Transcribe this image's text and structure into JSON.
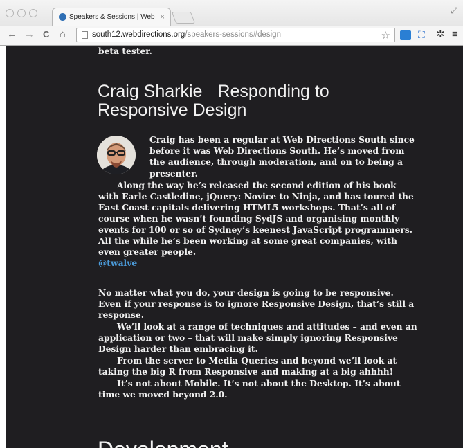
{
  "browser": {
    "tab_title": "Speakers & Sessions | Web D",
    "tab_close": "×",
    "url_host": "south12.webdirections.org",
    "url_path": "/speakers-sessions#design",
    "back": "←",
    "forward": "→",
    "reload": "C",
    "home": "⌂",
    "star": "☆",
    "gear": "✲",
    "menu": "≡",
    "resize": "⤢"
  },
  "page": {
    "prev_text": "beta tester.",
    "speaker": {
      "name": "Craig Sharkie",
      "talk_title_line1": "Responding to",
      "talk_title_line2": "Responsive Design",
      "bio_lines_indented": [
        "Craig has been a regular at Web Directions South since",
        "before it was Web Directions South. He’s moved from",
        "the audience, through moderation, and on to being a",
        "presenter."
      ],
      "bio_lines": [
        "Along the way he’s released the second edition of his book",
        "with Earle Castledine, jQuery: Novice to Ninja, and has toured the",
        "East Coast capitals delivering HTML5 workshops. That’s all of",
        "course when he wasn’t founding SydJS and organising monthly",
        "events for 100 or so of Sydney’s keenest JavaScript programmers.",
        "All the while he’s been working at some great companies, with",
        "even greater people."
      ],
      "twitter": "@twalve"
    },
    "abstract_lines": [
      "No matter what you do, your design is going to be responsive.",
      "Even if your response is to ignore Responsive Design, that’s still a",
      "response.",
      "We’ll look at a range of techniques and attitudes – and even an",
      "application or two – that will make simply ignoring Responsive",
      "Design harder than embracing it.",
      "From the server to Media Queries and beyond we’ll look at",
      "taking the big R from Responsive and making at a big ahhhh!",
      "It’s not about Mobile. It’s not about the Desktop. It’s about",
      "time we moved beyond 2.0."
    ],
    "next_heading": "Development"
  }
}
